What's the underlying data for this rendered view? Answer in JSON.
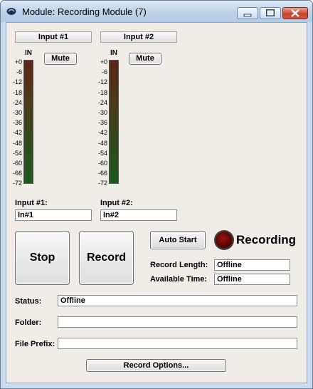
{
  "window": {
    "title": "Module: Recording Module (7)"
  },
  "inputs": [
    {
      "header": "Input #1",
      "meter_label": "IN",
      "mute_label": "Mute",
      "field_label": "Input #1:",
      "field_value": "In#1"
    },
    {
      "header": "Input #2",
      "meter_label": "IN",
      "mute_label": "Mute",
      "field_label": "Input #2:",
      "field_value": "In#2"
    }
  ],
  "meter_scale": [
    "+0",
    "-6",
    "-12",
    "-18",
    "-24",
    "-30",
    "-36",
    "-42",
    "-48",
    "-54",
    "-60",
    "-66",
    "-72"
  ],
  "transport": {
    "stop_label": "Stop",
    "record_label": "Record",
    "auto_start_label": "Auto Start",
    "recording_label": "Recording"
  },
  "info": {
    "record_length_label": "Record Length:",
    "record_length_value": "Offline",
    "available_time_label": "Available Time:",
    "available_time_value": "Offline"
  },
  "settings": {
    "status_label": "Status:",
    "status_value": "Offline",
    "folder_label": "Folder:",
    "folder_value": "",
    "prefix_label": "File Prefix:",
    "prefix_value": ""
  },
  "options_button_label": "Record Options...",
  "colors": {
    "client_bg": "#f0ede8",
    "led": "#8b0a0a",
    "titlebar": "#c9dcef"
  }
}
